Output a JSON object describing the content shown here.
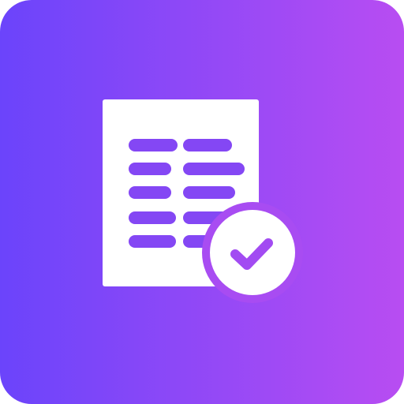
{
  "icon": {
    "name": "document-verified-app-icon",
    "glyph": "document-with-checkmark",
    "colors": {
      "gradient_start": "#6B44FB",
      "gradient_end": "#B84DF2",
      "paper": "#FFFFFF",
      "lines": "#8447F4",
      "badge_ring": "#A84CF2",
      "check": "#A24BF2"
    }
  }
}
